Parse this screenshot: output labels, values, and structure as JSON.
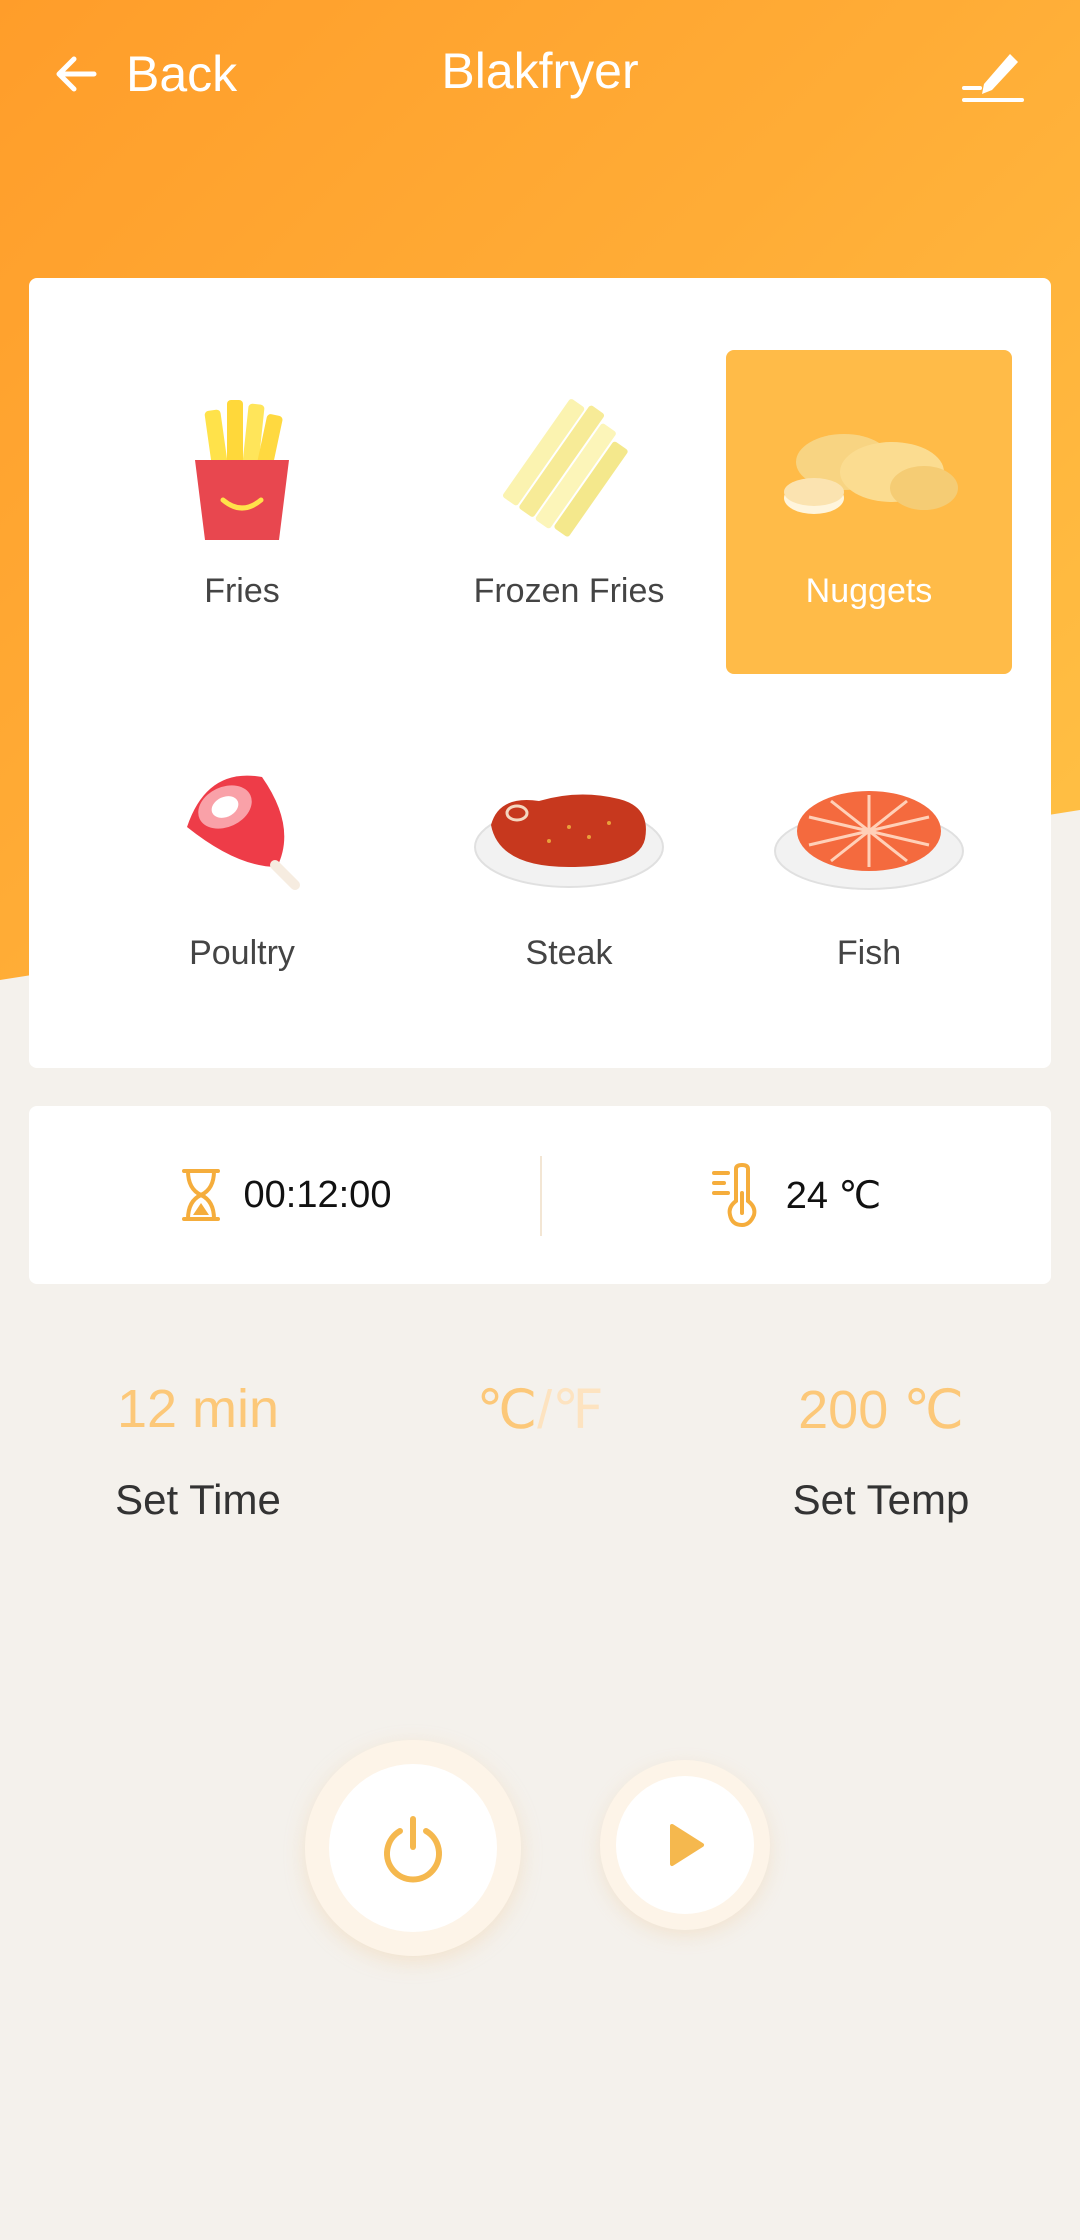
{
  "header": {
    "back_label": "Back",
    "title": "Blakfryer"
  },
  "foods": [
    {
      "label": "Fries",
      "icon": "fries-icon",
      "selected": false
    },
    {
      "label": "Frozen Fries",
      "icon": "frozen-fries-icon",
      "selected": false
    },
    {
      "label": "Nuggets",
      "icon": "nuggets-icon",
      "selected": true
    },
    {
      "label": "Poultry",
      "icon": "poultry-icon",
      "selected": false
    },
    {
      "label": "Steak",
      "icon": "steak-icon",
      "selected": false
    },
    {
      "label": "Fish",
      "icon": "fish-icon",
      "selected": false
    }
  ],
  "status": {
    "timer": "00:12:00",
    "temperature": "24 ℃"
  },
  "settings": {
    "time_value": "12 min",
    "time_caption": "Set Time",
    "unit_celsius": "℃",
    "unit_separator": "/",
    "unit_fahrenheit": "℉",
    "temp_value": "200 ℃",
    "temp_caption": "Set Temp"
  },
  "colors": {
    "accent": "#ffbb48",
    "accent_light": "#fcc879",
    "header_gradient_start": "#ff9d2a",
    "header_gradient_end": "#ffc246",
    "background": "#f4f1ec"
  }
}
